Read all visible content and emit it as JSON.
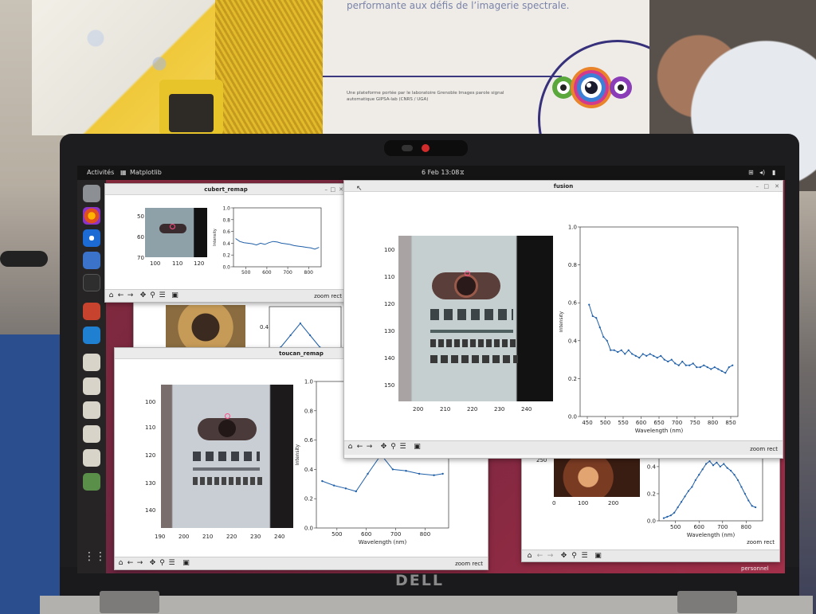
{
  "booth": {
    "poster_headline": "performante aux défis de l’imagerie spectrale.",
    "poster_small": "Une plateforme portée par le laboratoire Grenoble Images parole signal automatique GIPSA-lab (CNRS / UGA)"
  },
  "topbar": {
    "activities": "Activités",
    "app_name": "Matplotlib",
    "clock": "6 Feb  13:08"
  },
  "dock": {
    "icons": [
      "files-icon",
      "firefox-icon",
      "thunderbird-icon",
      "writer-icon",
      "terminal-icon",
      "media-icon",
      "vscode-icon",
      "python-icon",
      "python-icon",
      "python-icon",
      "python-icon",
      "python-icon",
      "trash-icon"
    ],
    "apps_grid": "⋮⋮"
  },
  "windows": {
    "cubert": {
      "title": "cubert_remap",
      "image_yticks": [
        "50",
        "60",
        "70"
      ],
      "image_xticks": [
        "100",
        "110",
        "120"
      ],
      "plot_yticks": [
        "0.0",
        "0.2",
        "0.4",
        "0.6",
        "0.8",
        "1.0"
      ],
      "plot_xticks": [
        "500",
        "600",
        "700",
        "800"
      ],
      "ylabel": "Intensity",
      "zoom_label": "zoom rect"
    },
    "fusion": {
      "title": "fusion",
      "image_yticks": [
        "100",
        "110",
        "120",
        "130",
        "140",
        "150"
      ],
      "image_xticks": [
        "200",
        "210",
        "220",
        "230",
        "240"
      ],
      "plot_yticks": [
        "0.0",
        "0.2",
        "0.4",
        "0.6",
        "0.8",
        "1.0"
      ],
      "plot_xticks": [
        "450",
        "500",
        "550",
        "600",
        "650",
        "700",
        "750",
        "800",
        "850"
      ],
      "ylabel": "Intensity",
      "xlabel": "Wavelength (nm)",
      "zoom_label": "zoom rect"
    },
    "toucan": {
      "title": "toucan_remap",
      "image_yticks": [
        "100",
        "110",
        "120",
        "130",
        "140"
      ],
      "image_xticks": [
        "190",
        "200",
        "210",
        "220",
        "230",
        "240"
      ],
      "plot_yticks": [
        "0.0",
        "0.2",
        "0.4",
        "0.6",
        "0.8",
        "1.0"
      ],
      "plot_xticks": [
        "500",
        "600",
        "700",
        "800"
      ],
      "ylabel": "Intensity",
      "xlabel": "Wavelength (nm)",
      "zoom_label": "zoom rect"
    },
    "back_left": {
      "plot_ytick": "0.4"
    },
    "back_right": {
      "image_ytick": "250",
      "image_xticks": [
        "0",
        "100",
        "200"
      ],
      "plot_yticks": [
        "0.0",
        "0.2",
        "0.4"
      ],
      "plot_xticks": [
        "500",
        "600",
        "700",
        "800"
      ],
      "xlabel": "Wavelength (nm)",
      "zoom_label": "zoom rect"
    }
  },
  "desktop_label": "personnel",
  "chart_data": [
    {
      "type": "line",
      "window": "cubert_remap",
      "xlabel": "",
      "ylabel": "Intensity",
      "xlim": [
        440,
        860
      ],
      "ylim": [
        0,
        1
      ],
      "x": [
        450,
        470,
        490,
        510,
        530,
        550,
        570,
        590,
        610,
        630,
        650,
        670,
        690,
        710,
        730,
        750,
        770,
        790,
        810,
        830,
        850
      ],
      "y": [
        0.48,
        0.43,
        0.41,
        0.4,
        0.39,
        0.37,
        0.4,
        0.38,
        0.41,
        0.43,
        0.42,
        0.4,
        0.39,
        0.38,
        0.36,
        0.35,
        0.34,
        0.33,
        0.32,
        0.3,
        0.33
      ]
    },
    {
      "type": "line",
      "window": "fusion",
      "xlabel": "Wavelength (nm)",
      "ylabel": "Intensity",
      "xlim": [
        430,
        870
      ],
      "ylim": [
        0,
        1
      ],
      "x": [
        455,
        465,
        475,
        485,
        495,
        505,
        515,
        525,
        535,
        545,
        555,
        565,
        575,
        585,
        595,
        605,
        615,
        625,
        635,
        645,
        655,
        665,
        675,
        685,
        695,
        705,
        715,
        725,
        735,
        745,
        755,
        765,
        775,
        785,
        795,
        805,
        815,
        825,
        835,
        845,
        855
      ],
      "y": [
        0.59,
        0.53,
        0.52,
        0.47,
        0.42,
        0.4,
        0.35,
        0.35,
        0.34,
        0.35,
        0.33,
        0.35,
        0.33,
        0.32,
        0.31,
        0.33,
        0.32,
        0.33,
        0.32,
        0.31,
        0.32,
        0.3,
        0.29,
        0.3,
        0.28,
        0.27,
        0.29,
        0.27,
        0.27,
        0.28,
        0.26,
        0.26,
        0.27,
        0.26,
        0.25,
        0.26,
        0.25,
        0.24,
        0.23,
        0.26,
        0.27
      ]
    },
    {
      "type": "line",
      "window": "toucan_remap",
      "xlabel": "Wavelength (nm)",
      "ylabel": "Intensity",
      "xlim": [
        430,
        880
      ],
      "ylim": [
        0,
        1
      ],
      "x": [
        450,
        490,
        530,
        565,
        605,
        650,
        690,
        735,
        780,
        830,
        860
      ],
      "y": [
        0.32,
        0.29,
        0.27,
        0.25,
        0.37,
        0.5,
        0.4,
        0.39,
        0.37,
        0.36,
        0.37
      ]
    },
    {
      "type": "line",
      "window": "back_right",
      "xlabel": "Wavelength (nm)",
      "ylabel": "",
      "xlim": [
        430,
        870
      ],
      "ylim": [
        0,
        0.47
      ],
      "x": [
        450,
        465,
        480,
        495,
        510,
        525,
        540,
        555,
        570,
        585,
        600,
        615,
        630,
        645,
        660,
        675,
        690,
        705,
        720,
        735,
        750,
        765,
        780,
        795,
        810,
        825,
        840
      ],
      "y": [
        0.02,
        0.03,
        0.04,
        0.06,
        0.1,
        0.14,
        0.18,
        0.22,
        0.25,
        0.3,
        0.34,
        0.38,
        0.42,
        0.44,
        0.41,
        0.43,
        0.4,
        0.42,
        0.39,
        0.37,
        0.34,
        0.3,
        0.25,
        0.2,
        0.15,
        0.11,
        0.1
      ]
    },
    {
      "type": "line",
      "window": "back_left",
      "xlabel": "",
      "ylabel": "",
      "xlim": [
        430,
        870
      ],
      "ylim": [
        0.3,
        0.5
      ],
      "x": [
        500,
        560,
        620,
        680,
        740
      ],
      "y": [
        0.33,
        0.38,
        0.43,
        0.38,
        0.33
      ]
    }
  ]
}
